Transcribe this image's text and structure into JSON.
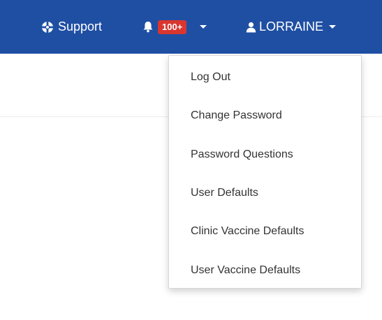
{
  "navbar": {
    "background": "#1f4fa3",
    "support": {
      "icon": "life-ring-icon",
      "label": "Support"
    },
    "notifications": {
      "icon": "bell-icon",
      "badge": "100+",
      "badge_color": "#d9362f"
    },
    "user": {
      "icon": "user-icon",
      "label": "LORRAINE"
    }
  },
  "user_menu": {
    "items": [
      {
        "label": "Log Out"
      },
      {
        "label": "Change Password"
      },
      {
        "label": "Password Questions"
      },
      {
        "label": "User Defaults"
      },
      {
        "label": "Clinic Vaccine Defaults"
      },
      {
        "label": "User Vaccine Defaults"
      }
    ]
  }
}
